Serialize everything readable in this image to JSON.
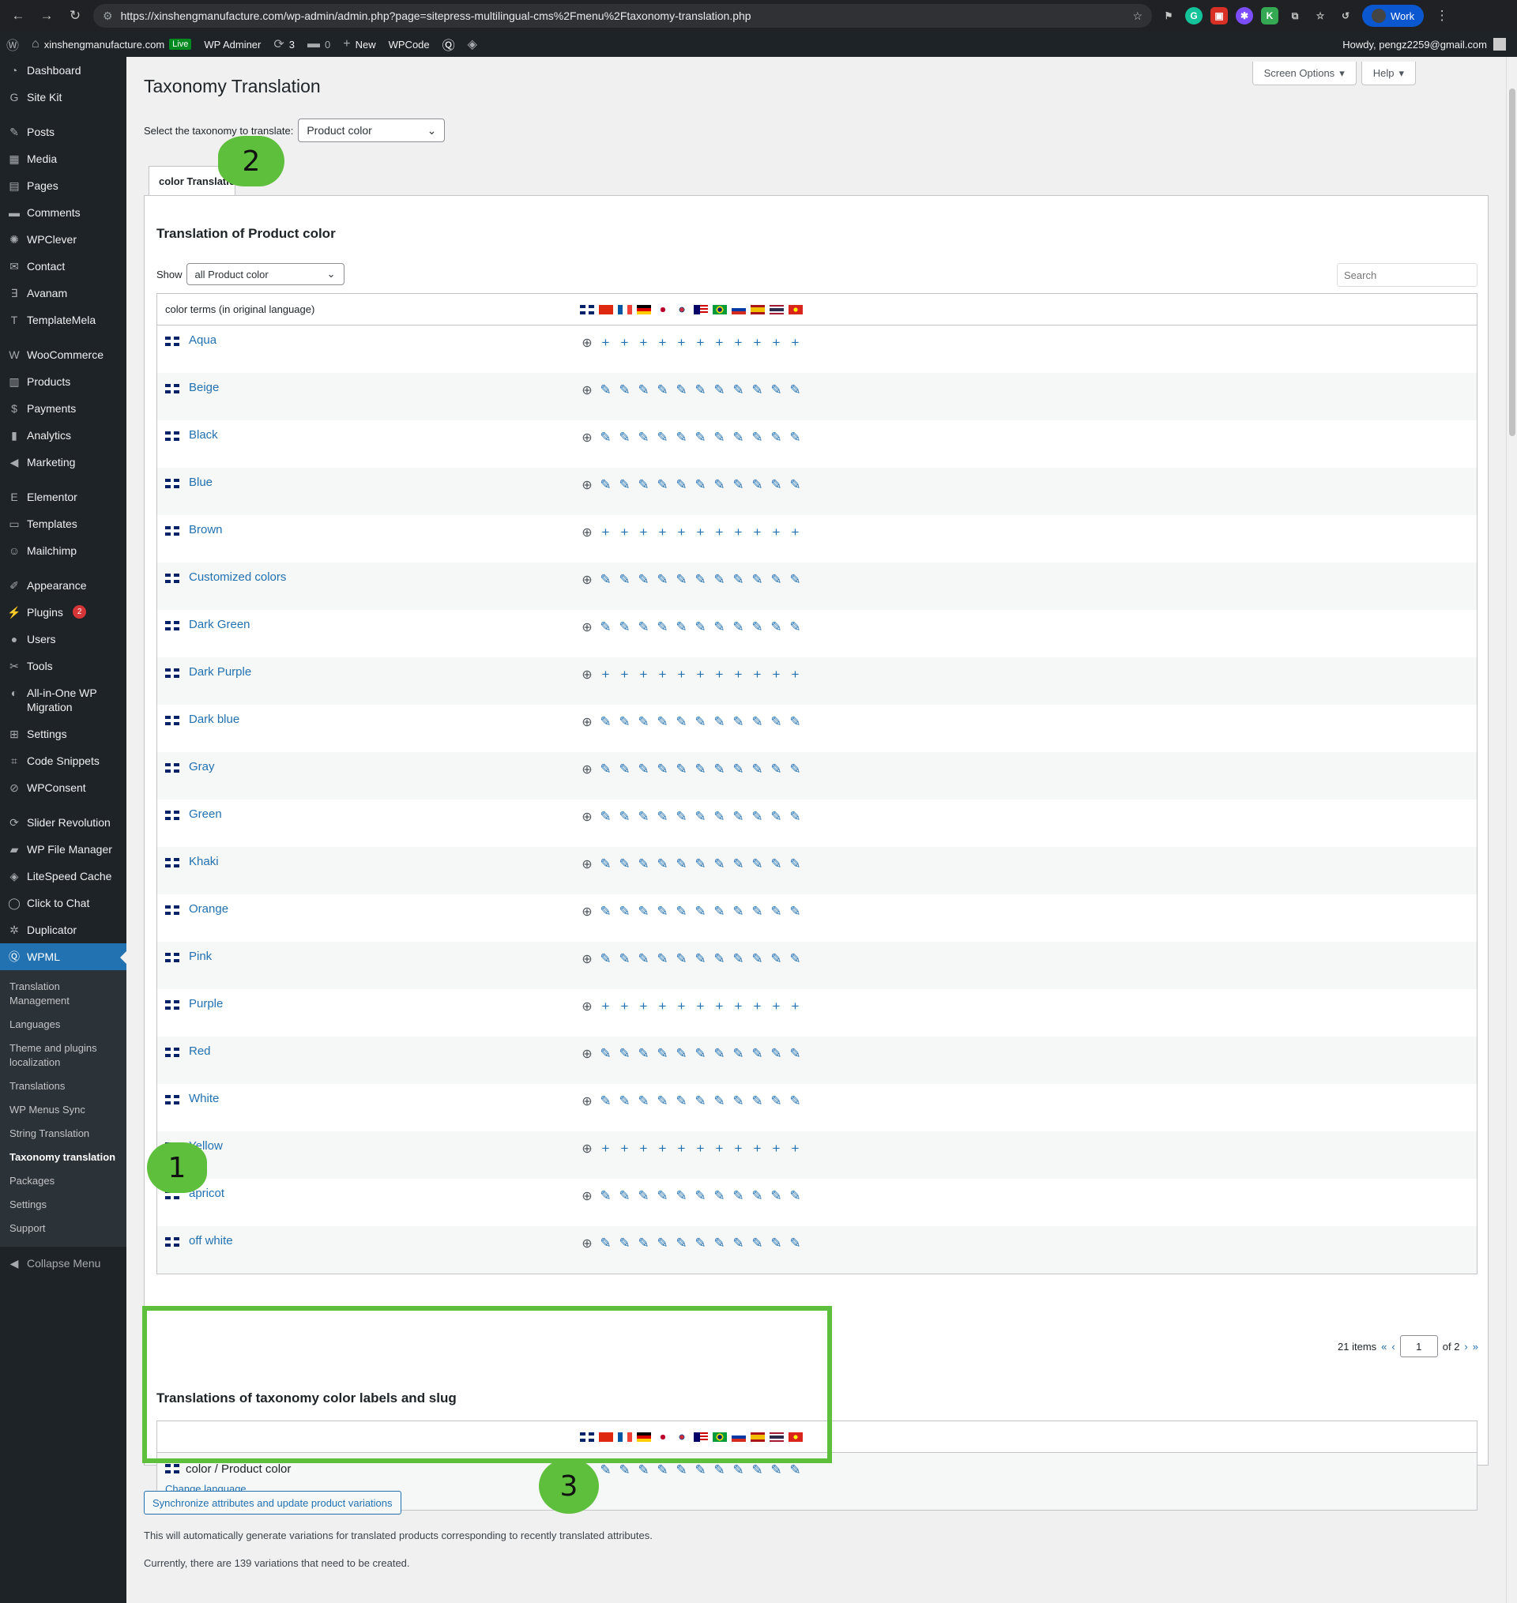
{
  "browser": {
    "url": "https://xinshengmanufacture.com/wp-admin/admin.php?page=sitepress-multilingual-cms%2Fmenu%2Ftaxonomy-translation.php",
    "profile": "Work"
  },
  "adminbar": {
    "site": "xinshengmanufacture.com",
    "live": "Live",
    "admin": "WP Adminer",
    "updates": "3",
    "comments": "0",
    "new": "New",
    "wpcode": "WPCode",
    "howdy": "Howdy, pengz2259@gmail.com"
  },
  "sidebar": {
    "items": [
      {
        "label": "Dashboard",
        "icon": "dashboard-icon"
      },
      {
        "label": "Site Kit",
        "icon": "sitekit-icon"
      },
      {
        "label": "Posts",
        "icon": "pin-icon"
      },
      {
        "label": "Media",
        "icon": "media-icon"
      },
      {
        "label": "Pages",
        "icon": "page-icon"
      },
      {
        "label": "Comments",
        "icon": "comment-icon"
      },
      {
        "label": "WPClever",
        "icon": "wpclever-icon"
      },
      {
        "label": "Contact",
        "icon": "mail-icon"
      },
      {
        "label": "Avanam",
        "icon": "avanam-icon"
      },
      {
        "label": "TemplateMela",
        "icon": "templatemela-icon"
      },
      {
        "label": "WooCommerce",
        "icon": "woo-icon"
      },
      {
        "label": "Products",
        "icon": "products-icon"
      },
      {
        "label": "Payments",
        "icon": "payments-icon"
      },
      {
        "label": "Analytics",
        "icon": "analytics-icon"
      },
      {
        "label": "Marketing",
        "icon": "marketing-icon"
      },
      {
        "label": "Elementor",
        "icon": "elementor-icon"
      },
      {
        "label": "Templates",
        "icon": "folder-icon"
      },
      {
        "label": "Mailchimp",
        "icon": "mailchimp-icon"
      },
      {
        "label": "Appearance",
        "icon": "brush-icon"
      },
      {
        "label": "Plugins",
        "icon": "plugin-icon",
        "badge": "2"
      },
      {
        "label": "Users",
        "icon": "user-icon"
      },
      {
        "label": "Tools",
        "icon": "wrench-icon"
      },
      {
        "label": "All-in-One WP Migration",
        "icon": "migration-icon"
      },
      {
        "label": "Settings",
        "icon": "settings-icon"
      },
      {
        "label": "Code Snippets",
        "icon": "code-icon"
      },
      {
        "label": "WPConsent",
        "icon": "consent-icon"
      },
      {
        "label": "Slider Revolution",
        "icon": "slider-icon"
      },
      {
        "label": "WP File Manager",
        "icon": "filemanager-icon"
      },
      {
        "label": "LiteSpeed Cache",
        "icon": "litespeed-icon"
      },
      {
        "label": "Click to Chat",
        "icon": "whatsapp-icon"
      },
      {
        "label": "Duplicator",
        "icon": "duplicator-icon"
      }
    ],
    "wpml": "WPML",
    "submenu": [
      "Translation Management",
      "Languages",
      "Theme and plugins localization",
      "Translations",
      "WP Menus Sync",
      "String Translation",
      "Taxonomy translation",
      "Packages",
      "Settings",
      "Support"
    ],
    "collapse": "Collapse Menu"
  },
  "header": {
    "title": "Taxonomy Translation",
    "screen_options": "Screen Options",
    "help": "Help"
  },
  "select": {
    "label": "Select the taxonomy to translate:",
    "value": "Product color"
  },
  "tab": {
    "label": "color Translation"
  },
  "panel": {
    "title": "Translation of Product color",
    "show_label": "Show",
    "show_value": "all Product color",
    "search_placeholder": "Search",
    "col_header": "color terms (in original language)"
  },
  "languages": [
    "en",
    "zh",
    "fr",
    "de",
    "ja",
    "ko",
    "ms",
    "pt-br",
    "ru",
    "es",
    "th",
    "vi"
  ],
  "terms": [
    {
      "name": "Aqua",
      "status": "add"
    },
    {
      "name": "Beige",
      "status": "edit"
    },
    {
      "name": "Black",
      "status": "edit"
    },
    {
      "name": "Blue",
      "status": "edit"
    },
    {
      "name": "Brown",
      "status": "add"
    },
    {
      "name": "Customized colors",
      "status": "edit"
    },
    {
      "name": "Dark Green",
      "status": "edit"
    },
    {
      "name": "Dark Purple",
      "status": "add"
    },
    {
      "name": "Dark blue",
      "status": "edit"
    },
    {
      "name": "Gray",
      "status": "edit"
    },
    {
      "name": "Green",
      "status": "edit"
    },
    {
      "name": "Khaki",
      "status": "edit"
    },
    {
      "name": "Orange",
      "status": "edit"
    },
    {
      "name": "Pink",
      "status": "edit"
    },
    {
      "name": "Purple",
      "status": "add"
    },
    {
      "name": "Red",
      "status": "edit"
    },
    {
      "name": "White",
      "status": "edit"
    },
    {
      "name": "Yellow",
      "status": "add"
    },
    {
      "name": "apricot",
      "status": "edit"
    },
    {
      "name": "off white",
      "status": "edit"
    }
  ],
  "pager": {
    "items": "21 items",
    "first": "«",
    "prev": "‹",
    "page": "1",
    "of": "of 2",
    "next": "›",
    "last": "»"
  },
  "labels": {
    "title": "Translations of taxonomy color labels and slug",
    "name": "color / Product color",
    "change": "Change language"
  },
  "sync": {
    "button": "Synchronize attributes and update product variations",
    "note1": "This will automatically generate variations for translated products corresponding to recently translated attributes.",
    "note2": "Currently, there are 139 variations that need to be created."
  },
  "callouts": [
    "1",
    "2",
    "3"
  ],
  "colors": {
    "accent": "#2271b1",
    "sidebar": "#1d2327",
    "active": "#2271b1",
    "callout": "#5ebf3c"
  }
}
